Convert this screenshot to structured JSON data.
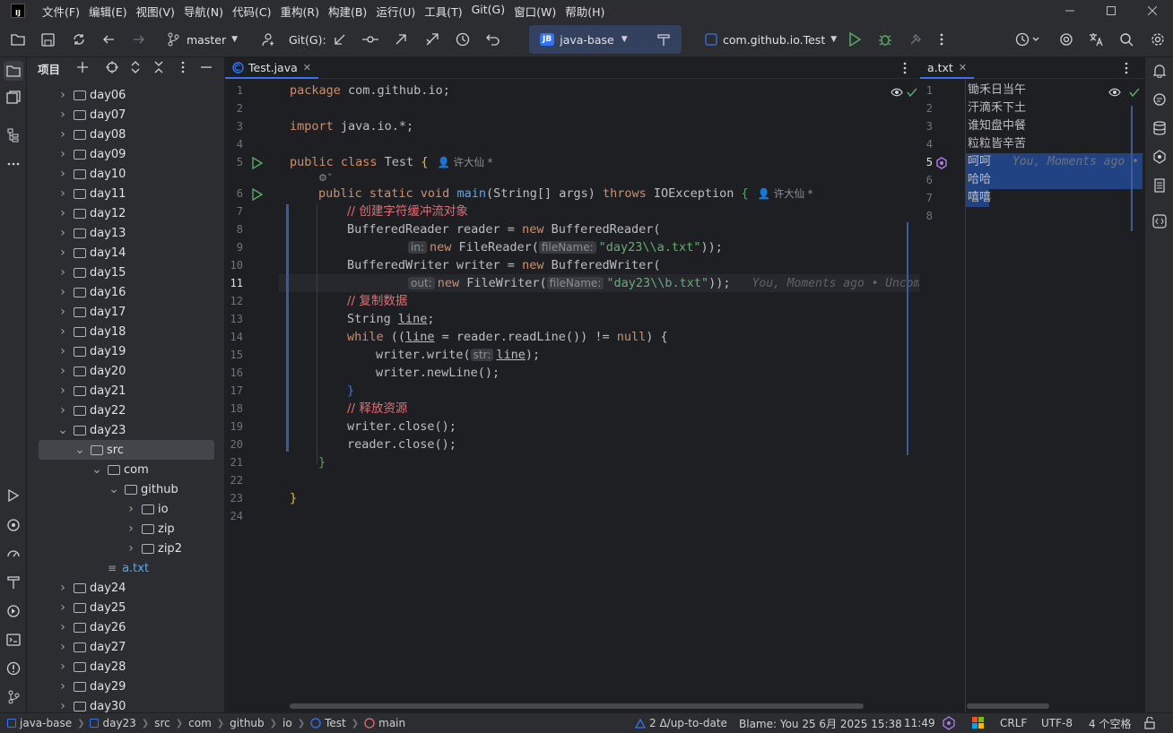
{
  "titlebar": {
    "logo": "IJ",
    "menu": [
      "文件(F)",
      "编辑(E)",
      "视图(V)",
      "导航(N)",
      "代码(C)",
      "重构(R)",
      "构建(B)",
      "运行(U)",
      "工具(T)",
      "Git(G)",
      "窗口(W)",
      "帮助(H)"
    ]
  },
  "toolbar": {
    "branch": "master",
    "git_label": "Git(G):",
    "project_badge": "JB",
    "project_name": "java-base",
    "run_config": "com.github.io.Test"
  },
  "project_panel": {
    "title": "项目",
    "tree": [
      {
        "label": "day06",
        "depth": 0,
        "type": "folder",
        "expanded": false
      },
      {
        "label": "day07",
        "depth": 0,
        "type": "folder",
        "expanded": false
      },
      {
        "label": "day08",
        "depth": 0,
        "type": "folder",
        "expanded": false
      },
      {
        "label": "day09",
        "depth": 0,
        "type": "folder",
        "expanded": false
      },
      {
        "label": "day10",
        "depth": 0,
        "type": "folder",
        "expanded": false
      },
      {
        "label": "day11",
        "depth": 0,
        "type": "folder",
        "expanded": false
      },
      {
        "label": "day12",
        "depth": 0,
        "type": "folder",
        "expanded": false
      },
      {
        "label": "day13",
        "depth": 0,
        "type": "folder",
        "expanded": false
      },
      {
        "label": "day14",
        "depth": 0,
        "type": "folder",
        "expanded": false
      },
      {
        "label": "day15",
        "depth": 0,
        "type": "folder",
        "expanded": false
      },
      {
        "label": "day16",
        "depth": 0,
        "type": "folder",
        "expanded": false
      },
      {
        "label": "day17",
        "depth": 0,
        "type": "folder",
        "expanded": false
      },
      {
        "label": "day18",
        "depth": 0,
        "type": "folder",
        "expanded": false
      },
      {
        "label": "day19",
        "depth": 0,
        "type": "folder",
        "expanded": false
      },
      {
        "label": "day20",
        "depth": 0,
        "type": "folder",
        "expanded": false
      },
      {
        "label": "day21",
        "depth": 0,
        "type": "folder",
        "expanded": false
      },
      {
        "label": "day22",
        "depth": 0,
        "type": "folder",
        "expanded": false
      },
      {
        "label": "day23",
        "depth": 0,
        "type": "folder",
        "expanded": true
      },
      {
        "label": "src",
        "depth": 1,
        "type": "folder",
        "expanded": true,
        "selected": true
      },
      {
        "label": "com",
        "depth": 2,
        "type": "folder",
        "expanded": true
      },
      {
        "label": "github",
        "depth": 3,
        "type": "folder",
        "expanded": true
      },
      {
        "label": "io",
        "depth": 4,
        "type": "folder",
        "expanded": false
      },
      {
        "label": "zip",
        "depth": 4,
        "type": "folder",
        "expanded": false
      },
      {
        "label": "zip2",
        "depth": 4,
        "type": "folder",
        "expanded": false
      },
      {
        "label": "a.txt",
        "depth": 2,
        "type": "file",
        "expanded": false
      },
      {
        "label": "day24",
        "depth": 0,
        "type": "folder",
        "expanded": false
      },
      {
        "label": "day25",
        "depth": 0,
        "type": "folder",
        "expanded": false
      },
      {
        "label": "day26",
        "depth": 0,
        "type": "folder",
        "expanded": false
      },
      {
        "label": "day27",
        "depth": 0,
        "type": "folder",
        "expanded": false
      },
      {
        "label": "day28",
        "depth": 0,
        "type": "folder",
        "expanded": false
      },
      {
        "label": "day29",
        "depth": 0,
        "type": "folder",
        "expanded": false
      },
      {
        "label": "day30",
        "depth": 0,
        "type": "folder",
        "expanded": false
      }
    ]
  },
  "editor_main": {
    "tab": "Test.java",
    "line_numbers": [
      "1",
      "2",
      "3",
      "4",
      "5",
      "6",
      "7",
      "8",
      "9",
      "10",
      "11",
      "12",
      "13",
      "14",
      "15",
      "16",
      "17",
      "18",
      "19",
      "20",
      "21",
      "22",
      "23",
      "24"
    ],
    "author": "许大仙 *",
    "hint_in": "in:",
    "hint_filename": "fileName:",
    "hint_out": "out:",
    "hint_str": "str:",
    "blame_inline": "You, Moments ago • Uncom",
    "code": {
      "l1_kw": "package",
      "l1_rest": " com.github.io;",
      "l3_kw": "import",
      "l3_rest": " java.io.*;",
      "l5_a": "public class",
      "l5_b": " Test ",
      "l5_c": "{",
      "l6_a": "public static void",
      "l6_fn": "main",
      "l6_b": "(String[] args) ",
      "l6_kw": "throws",
      "l6_c": " IOException ",
      "l6_d": "{",
      "l7": "// 创建字符缓冲流对象",
      "l8_a": "BufferedReader reader = ",
      "l8_kw": "new",
      "l8_b": " BufferedReader(",
      "l9_kw": "new",
      "l9_a": " FileReader(",
      "l9_str": "\"day23\\\\a.txt\"",
      "l9_b": "));",
      "l10_a": "BufferedWriter writer = ",
      "l10_kw": "new",
      "l10_b": " BufferedWriter(",
      "l11_kw": "new",
      "l11_a": " FileWriter(",
      "l11_str": "\"day23\\\\b.txt\"",
      "l11_b": "));",
      "l12": "// 复制数据",
      "l13_a": "String ",
      "l13_u": "line",
      "l13_b": ";",
      "l14_kw": "while",
      "l14_a": " ((",
      "l14_u": "line",
      "l14_b": " = reader.readLine()) != ",
      "l14_kw2": "null",
      "l14_c": ") {",
      "l15_a": "writer.write(",
      "l15_u": "line",
      "l15_b": ");",
      "l16": "writer.newLine();",
      "l17": "}",
      "l18": "// 释放资源",
      "l19": "writer.close();",
      "l20": "reader.close();",
      "l21": "}",
      "l23": "}"
    }
  },
  "editor_side": {
    "tab": "a.txt",
    "line_numbers": [
      "1",
      "2",
      "3",
      "4",
      "5",
      "6",
      "7",
      "8"
    ],
    "lines": [
      "锄禾日当午",
      "汗滴禾下土",
      "谁知盘中餐",
      "粒粒皆辛苦",
      "呵呵",
      "哈哈",
      "嘻嘻",
      ""
    ],
    "blame": "You, Moments ago •"
  },
  "statusbar": {
    "breadcrumbs": [
      "java-base",
      "day23",
      "src",
      "com",
      "github",
      "io",
      "Test",
      "main"
    ],
    "vcs": "2 Δ/up-to-date",
    "blame": "Blame: You 25 6月 2025 15:38",
    "position": "11:49",
    "line_sep": "CRLF",
    "encoding": "UTF-8",
    "indent": "4 个空格"
  }
}
